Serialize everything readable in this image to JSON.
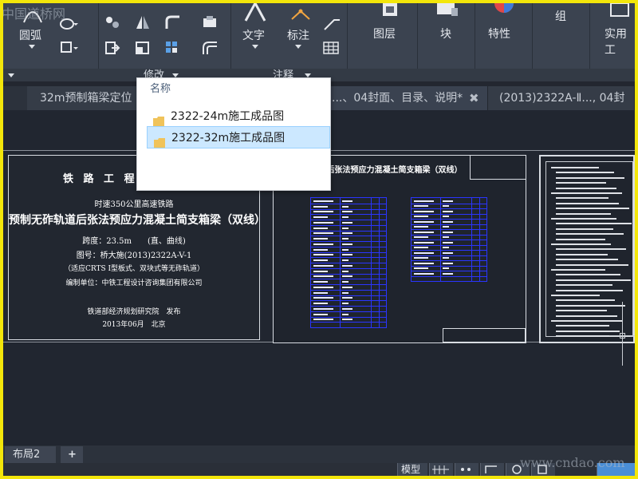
{
  "ribbon": {
    "items": {
      "arc": "圆弧",
      "text": "文字",
      "dimension": "标注",
      "layers": "图层",
      "block": "块",
      "properties": "特性",
      "group": "组",
      "utilities": "实用工"
    },
    "panels": {
      "modify": "修改",
      "annotation": "注释"
    }
  },
  "tabs": [
    {
      "label": "32m预制箱梁定位"
    },
    {
      "label": "...、04封面、目录、说明*"
    },
    {
      "label": "(2013)2322A-Ⅱ..., 04封"
    }
  ],
  "popup": {
    "header": "名称",
    "items": [
      {
        "label": "2322-24m施工成品图",
        "selected": false
      },
      {
        "label": "2322-32m施工成品图",
        "selected": true
      }
    ]
  },
  "sheet1": {
    "heading": "铁 路 工 程 建",
    "lines": [
      "时速350公里高速铁路",
      "预制无砟轨道后张法预应力混凝土简支箱梁（双线）",
      "跨度：23.5m　　(直、曲线)",
      "图号：桥大施(2013)2322A-V-1",
      "（适应CRTS I型板式、双块式等无砟轨道）",
      "编制单位：中铁工程设计咨询集团有限公司",
      "铁道部经济规划研究院　发布",
      "2013年06月　北京"
    ]
  },
  "sheet2": {
    "title": "...后张法预应力混凝土简支箱梁（双线）"
  },
  "layout_tabs": {
    "current": "布局2",
    "add": "+"
  },
  "status": {
    "model": "模型"
  },
  "watermarks": {
    "top_left": "中国道桥网",
    "bottom_right": "www.cndao.com"
  },
  "colors": {
    "highlight_border": "#f3e60a",
    "ribbon": "#3b4350",
    "table_lines": "#2a35ff",
    "selection": "#cce8ff"
  }
}
